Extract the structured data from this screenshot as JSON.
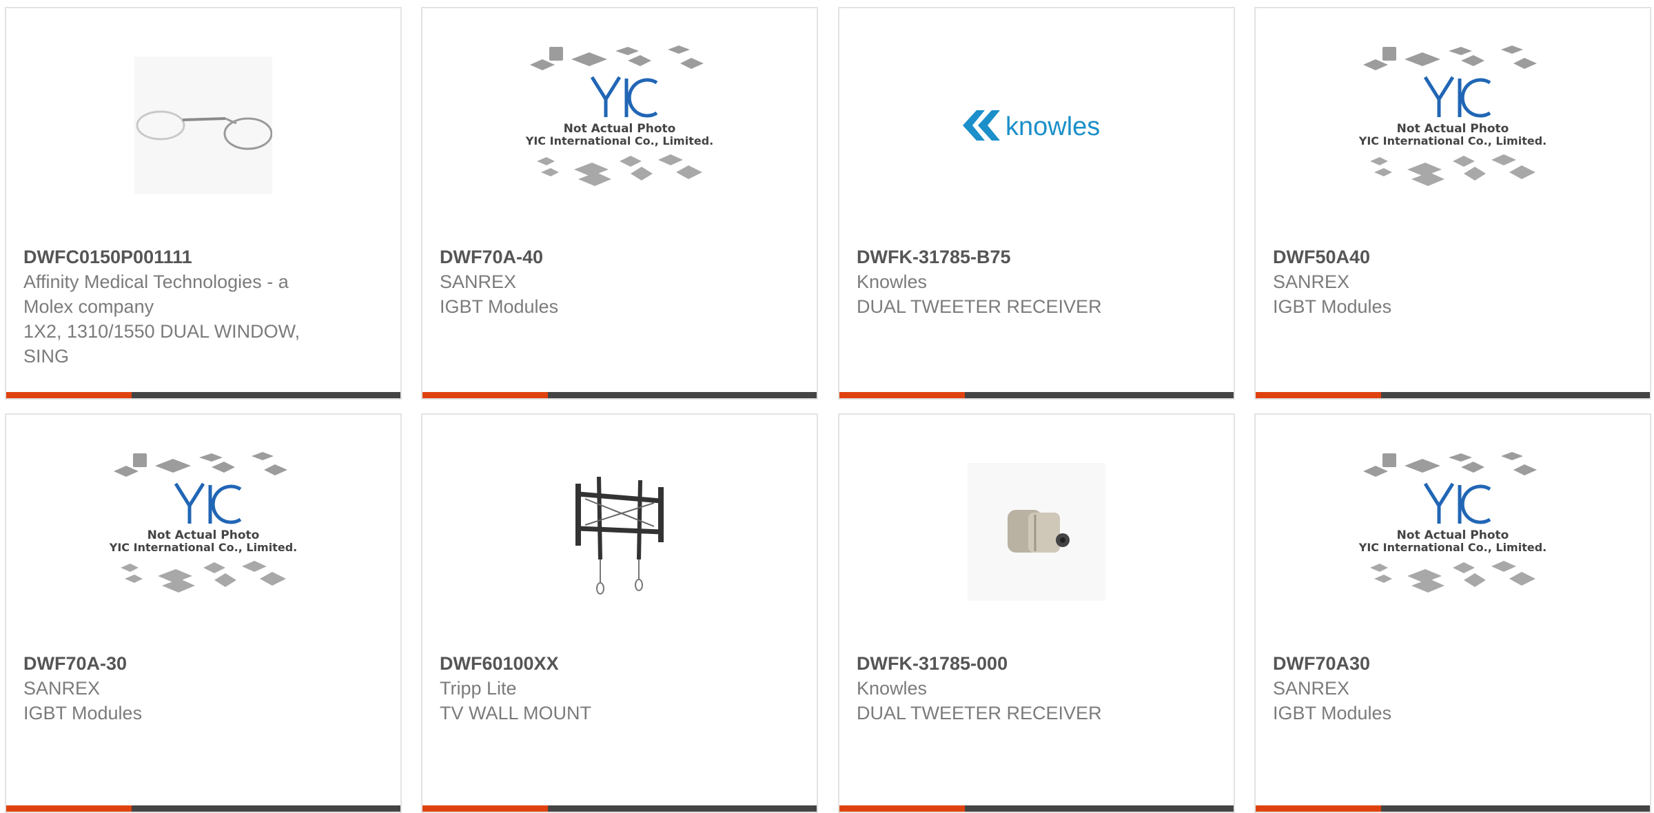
{
  "colors": {
    "accent": "#e0420f",
    "bar": "#444444",
    "part_text": "#555555",
    "meta_text": "#7b7b7b",
    "knowles_blue": "#1b8fc9",
    "yic_blue": "#2166b5"
  },
  "yic_placeholder": {
    "logo": "YIC",
    "line1": "Not Actual Photo",
    "line2": "YIC International Co., Limited."
  },
  "knowles_logo": "knowles",
  "products": [
    {
      "part": "DWFC0150P001111",
      "manufacturer_line1": "Affinity Medical Technologies - a",
      "manufacturer_line2": "Molex company",
      "description_line1": "1X2, 1310/1550 DUAL WINDOW,",
      "description_line2": "SING",
      "image": "fiber-coupler-icon"
    },
    {
      "part": "DWF70A-40",
      "manufacturer": "SANREX",
      "description": "IGBT Modules",
      "image": "yic-placeholder"
    },
    {
      "part": "DWFK-31785-B75",
      "manufacturer": "Knowles",
      "description": "DUAL TWEETER RECEIVER",
      "image": "knowles-logo"
    },
    {
      "part": "DWF50A40",
      "manufacturer": "SANREX",
      "description": "IGBT Modules",
      "image": "yic-placeholder"
    },
    {
      "part": "DWF70A-30",
      "manufacturer": "SANREX",
      "description": "IGBT Modules",
      "image": "yic-placeholder"
    },
    {
      "part": "DWF60100XX",
      "manufacturer": "Tripp Lite",
      "description": "TV WALL MOUNT",
      "image": "tv-mount-icon"
    },
    {
      "part": "DWFK-31785-000",
      "manufacturer": "Knowles",
      "description": "DUAL TWEETER RECEIVER",
      "image": "receiver-icon"
    },
    {
      "part": "DWF70A30",
      "manufacturer": "SANREX",
      "description": "IGBT Modules",
      "image": "yic-placeholder"
    }
  ]
}
